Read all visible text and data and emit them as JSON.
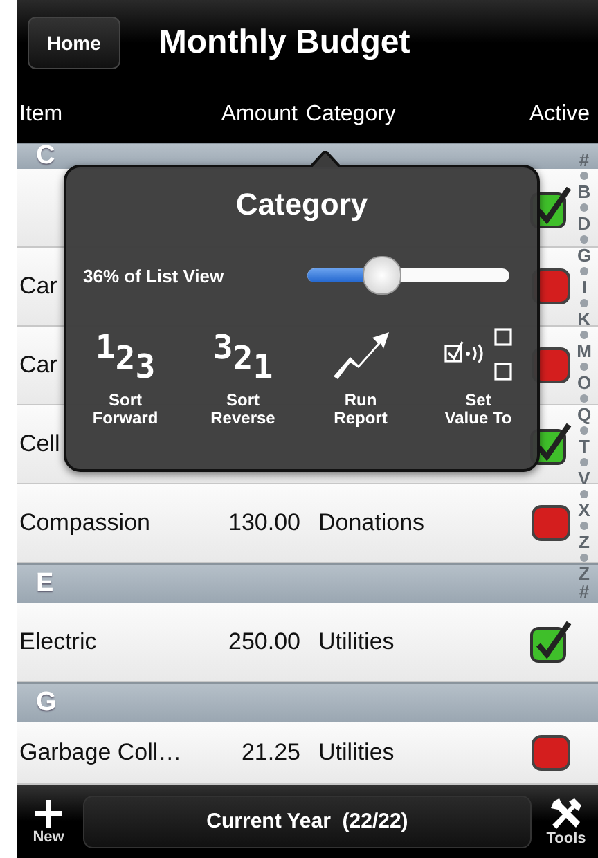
{
  "nav_bar": {
    "home_button": "Home",
    "title": "Monthly Budget"
  },
  "columns": [
    "Item",
    "Amount",
    "Category",
    "Active"
  ],
  "list": [
    {
      "kind": "section",
      "label": "C"
    },
    {
      "kind": "row",
      "active": true
    },
    {
      "kind": "row",
      "item": "Car",
      "active": false
    },
    {
      "kind": "row",
      "item": "Car",
      "active": false
    },
    {
      "kind": "row",
      "item": "Cell",
      "active": true
    },
    {
      "kind": "row",
      "item": "Compassion",
      "amount": "130.00",
      "category": "Donations",
      "active": false
    },
    {
      "kind": "section",
      "label": "E"
    },
    {
      "kind": "row",
      "item": "Electric",
      "amount": "250.00",
      "category": "Utilities",
      "active": true
    },
    {
      "kind": "section",
      "label": "G"
    },
    {
      "kind": "row",
      "item": "Garbage Coll…",
      "amount": "21.25",
      "category": "Utilities",
      "active": false
    }
  ],
  "index": [
    {
      "kind": "letter",
      "text": "#"
    },
    {
      "kind": "dot"
    },
    {
      "kind": "letter",
      "text": "B"
    },
    {
      "kind": "dot"
    },
    {
      "kind": "letter",
      "text": "D"
    },
    {
      "kind": "dot"
    },
    {
      "kind": "letter",
      "text": "G"
    },
    {
      "kind": "dot"
    },
    {
      "kind": "letter",
      "text": "I"
    },
    {
      "kind": "dot"
    },
    {
      "kind": "letter",
      "text": "K"
    },
    {
      "kind": "dot"
    },
    {
      "kind": "letter",
      "text": "M"
    },
    {
      "kind": "dot"
    },
    {
      "kind": "letter",
      "text": "O"
    },
    {
      "kind": "dot"
    },
    {
      "kind": "letter",
      "text": "Q"
    },
    {
      "kind": "dot"
    },
    {
      "kind": "letter",
      "text": "T"
    },
    {
      "kind": "dot"
    },
    {
      "kind": "letter",
      "text": "V"
    },
    {
      "kind": "dot"
    },
    {
      "kind": "letter",
      "text": "X"
    },
    {
      "kind": "dot"
    },
    {
      "kind": "letter",
      "text": "Z"
    },
    {
      "kind": "dot"
    },
    {
      "kind": "letter",
      "text": "Z"
    },
    {
      "kind": "letter",
      "text": "#"
    }
  ],
  "popover": {
    "title": "Category",
    "slider_label": "36% of List View",
    "level": 0.36,
    "actions": [
      {
        "kind": "digits",
        "digits": [
          "1",
          "2",
          "3"
        ],
        "label_lines": [
          "Sort",
          "Forward"
        ]
      },
      {
        "kind": "digits",
        "digits": [
          "3",
          "2",
          "1"
        ],
        "label_lines": [
          "Sort",
          "Reverse"
        ]
      },
      {
        "kind": "chart",
        "label_lines": [
          "Run",
          "Report"
        ]
      },
      {
        "kind": "set",
        "label_lines": [
          "Set",
          "Value To"
        ]
      }
    ]
  },
  "bottom_bar": {
    "new_label": "New",
    "filter_button": "Current Year  (22/22)",
    "tools_label": "Tools"
  }
}
